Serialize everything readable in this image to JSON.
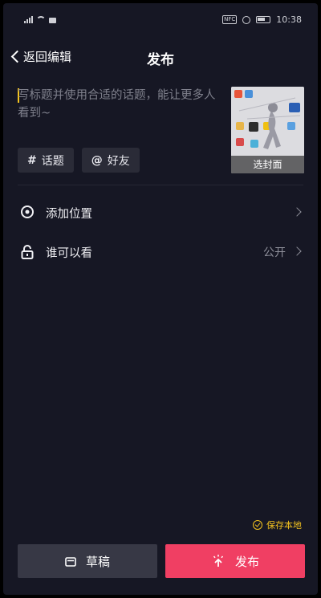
{
  "status_bar": {
    "time": "10:38",
    "nfc": "NFC"
  },
  "header": {
    "back_label": "返回编辑",
    "title": "发布"
  },
  "caption": {
    "placeholder": "写标题并使用合适的话题，能让更多人看到~"
  },
  "thumbnail": {
    "label": "选封面"
  },
  "chips": [
    {
      "icon": "#",
      "label": "话题"
    },
    {
      "icon": "@",
      "label": "好友"
    }
  ],
  "rows": {
    "location": {
      "label": "添加位置"
    },
    "privacy": {
      "label": "谁可以看",
      "value": "公开"
    }
  },
  "save_local": {
    "label": "保存本地"
  },
  "buttons": {
    "draft": "草稿",
    "publish": "发布"
  },
  "colors": {
    "background": "#161724",
    "accent_yellow": "#f4c31f",
    "publish_pink": "#f03f63",
    "draft_gray": "#373845"
  }
}
